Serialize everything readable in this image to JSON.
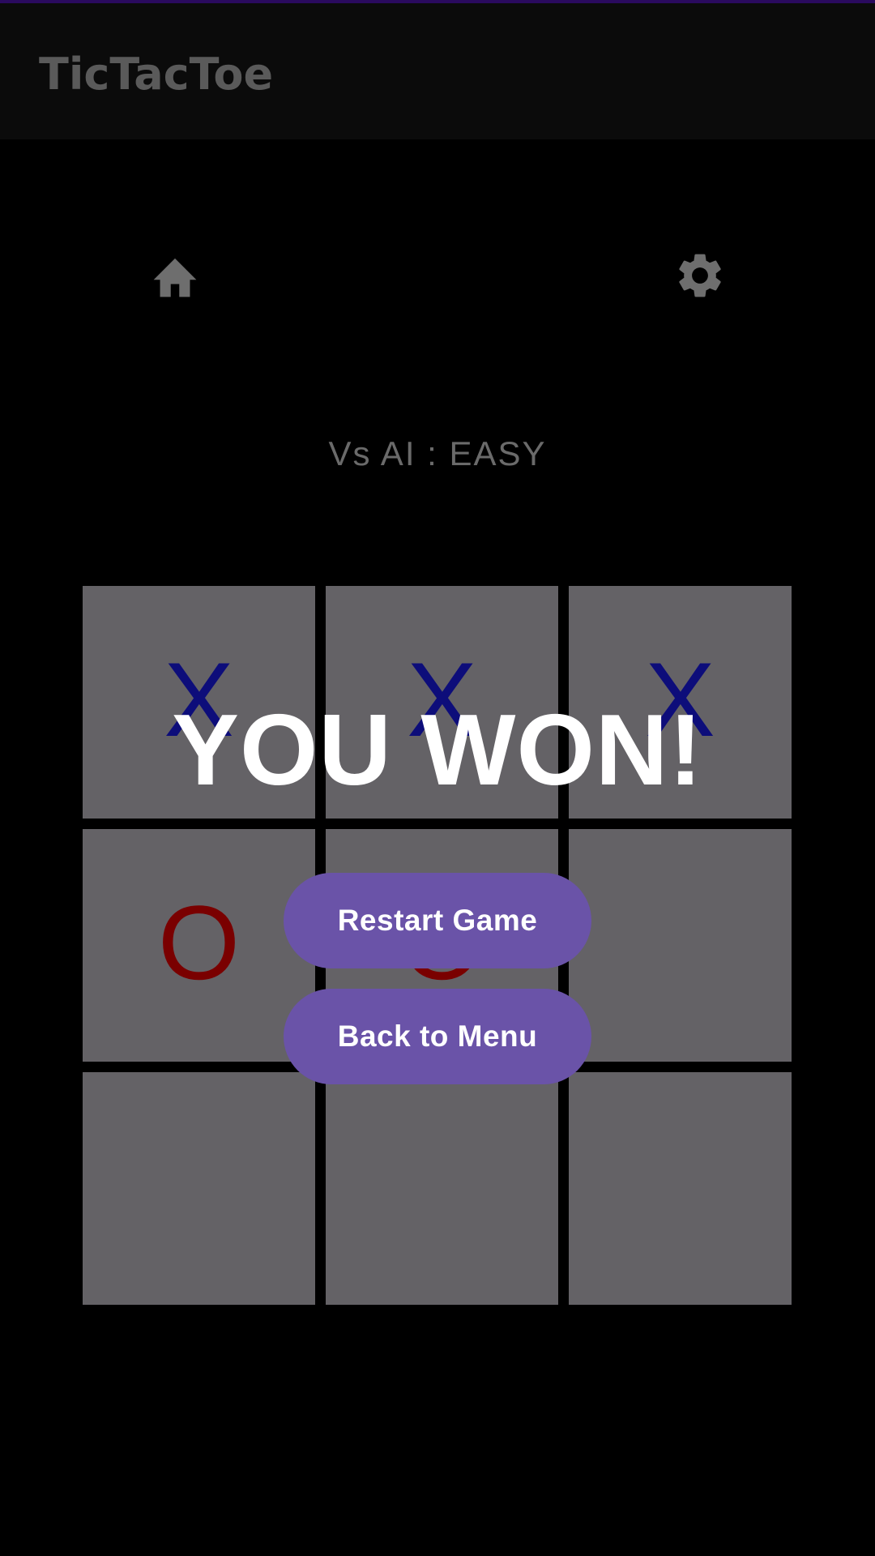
{
  "app_bar": {
    "title": "TicTacToe"
  },
  "toolbar": {
    "home_icon": "home-icon",
    "settings_icon": "gear-icon"
  },
  "game": {
    "mode_label": "Vs AI : EASY",
    "board": [
      "X",
      "X",
      "X",
      "O",
      "O",
      "",
      "",
      "",
      ""
    ],
    "result_text": "YOU WON!"
  },
  "dialog": {
    "restart_label": "Restart Game",
    "menu_label": "Back to Menu"
  },
  "colors": {
    "x_mark": "#0d0d7a",
    "o_mark": "#7a0000",
    "cell_bg": "#646266",
    "button_bg": "#6a53a8"
  }
}
